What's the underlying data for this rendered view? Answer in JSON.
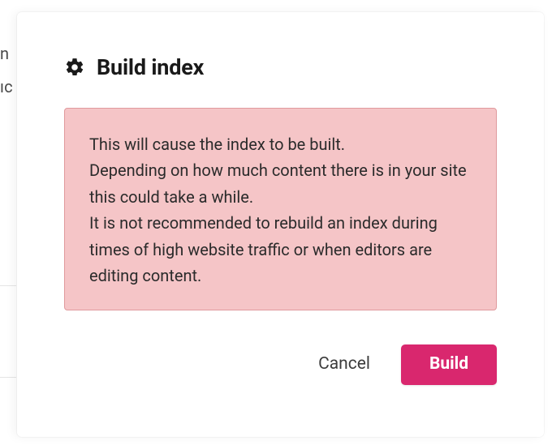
{
  "background": {
    "frag1": "n",
    "frag2": "ıc"
  },
  "modal": {
    "title": "Build index",
    "warning_line1": "This will cause the index to be built.",
    "warning_line2": "Depending on how much content there is in your site this could take a while.",
    "warning_line3": "It is not recommended to rebuild an index during times of high website traffic or when editors are editing content.",
    "actions": {
      "cancel": "Cancel",
      "build": "Build"
    }
  },
  "colors": {
    "primary": "#d9276e",
    "warning_bg": "#f5c5c7",
    "warning_border": "#e09a9d"
  }
}
